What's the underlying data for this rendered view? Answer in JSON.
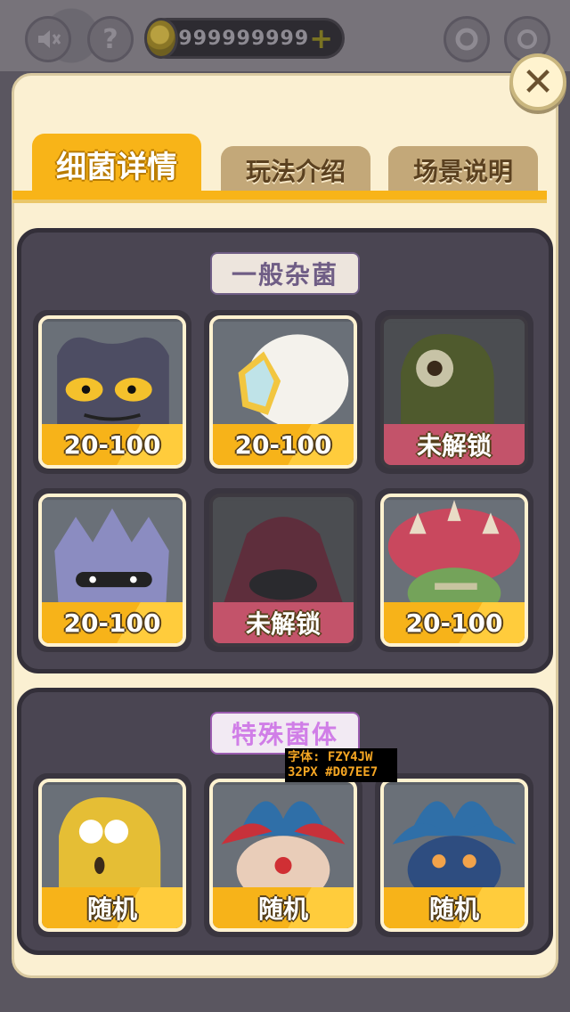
{
  "topbar": {
    "coins": "999999999",
    "plus_label": "+",
    "help_label": "?"
  },
  "tabs": [
    {
      "label": "细菌详情",
      "active": true
    },
    {
      "label": "玩法介绍",
      "active": false
    },
    {
      "label": "场景说明",
      "active": false
    }
  ],
  "close_label": "✕",
  "section_general": {
    "title": "一般杂菌",
    "title_color": "#6f5d85",
    "cards": [
      {
        "label": "20-100",
        "creature": "dark-horned-blob",
        "locked": false
      },
      {
        "label": "20-100",
        "creature": "white-crystal-puff",
        "locked": false
      },
      {
        "label": "未解锁",
        "creature": "green-cyclops",
        "locked": true
      },
      {
        "label": "20-100",
        "creature": "spiky-violet-blob",
        "locked": false
      },
      {
        "label": "未解锁",
        "creature": "hooded-shadow",
        "locked": true
      },
      {
        "label": "20-100",
        "creature": "mushroom-zombie",
        "locked": false
      }
    ]
  },
  "section_special": {
    "title": "特殊菌体",
    "title_color": "#D07EE7",
    "cards": [
      {
        "label": "随机",
        "creature": "yellow-blob",
        "locked": false
      },
      {
        "label": "随机",
        "creature": "jester-clown",
        "locked": false
      },
      {
        "label": "随机",
        "creature": "jester-blue",
        "locked": false
      }
    ]
  },
  "annotation": {
    "line1": "字体: FZY4JW",
    "line2": "32PX #D07EE7"
  },
  "colors": {
    "accent": "#f8b418",
    "panel": "#fbf0d2",
    "locked": "#c3536a"
  }
}
